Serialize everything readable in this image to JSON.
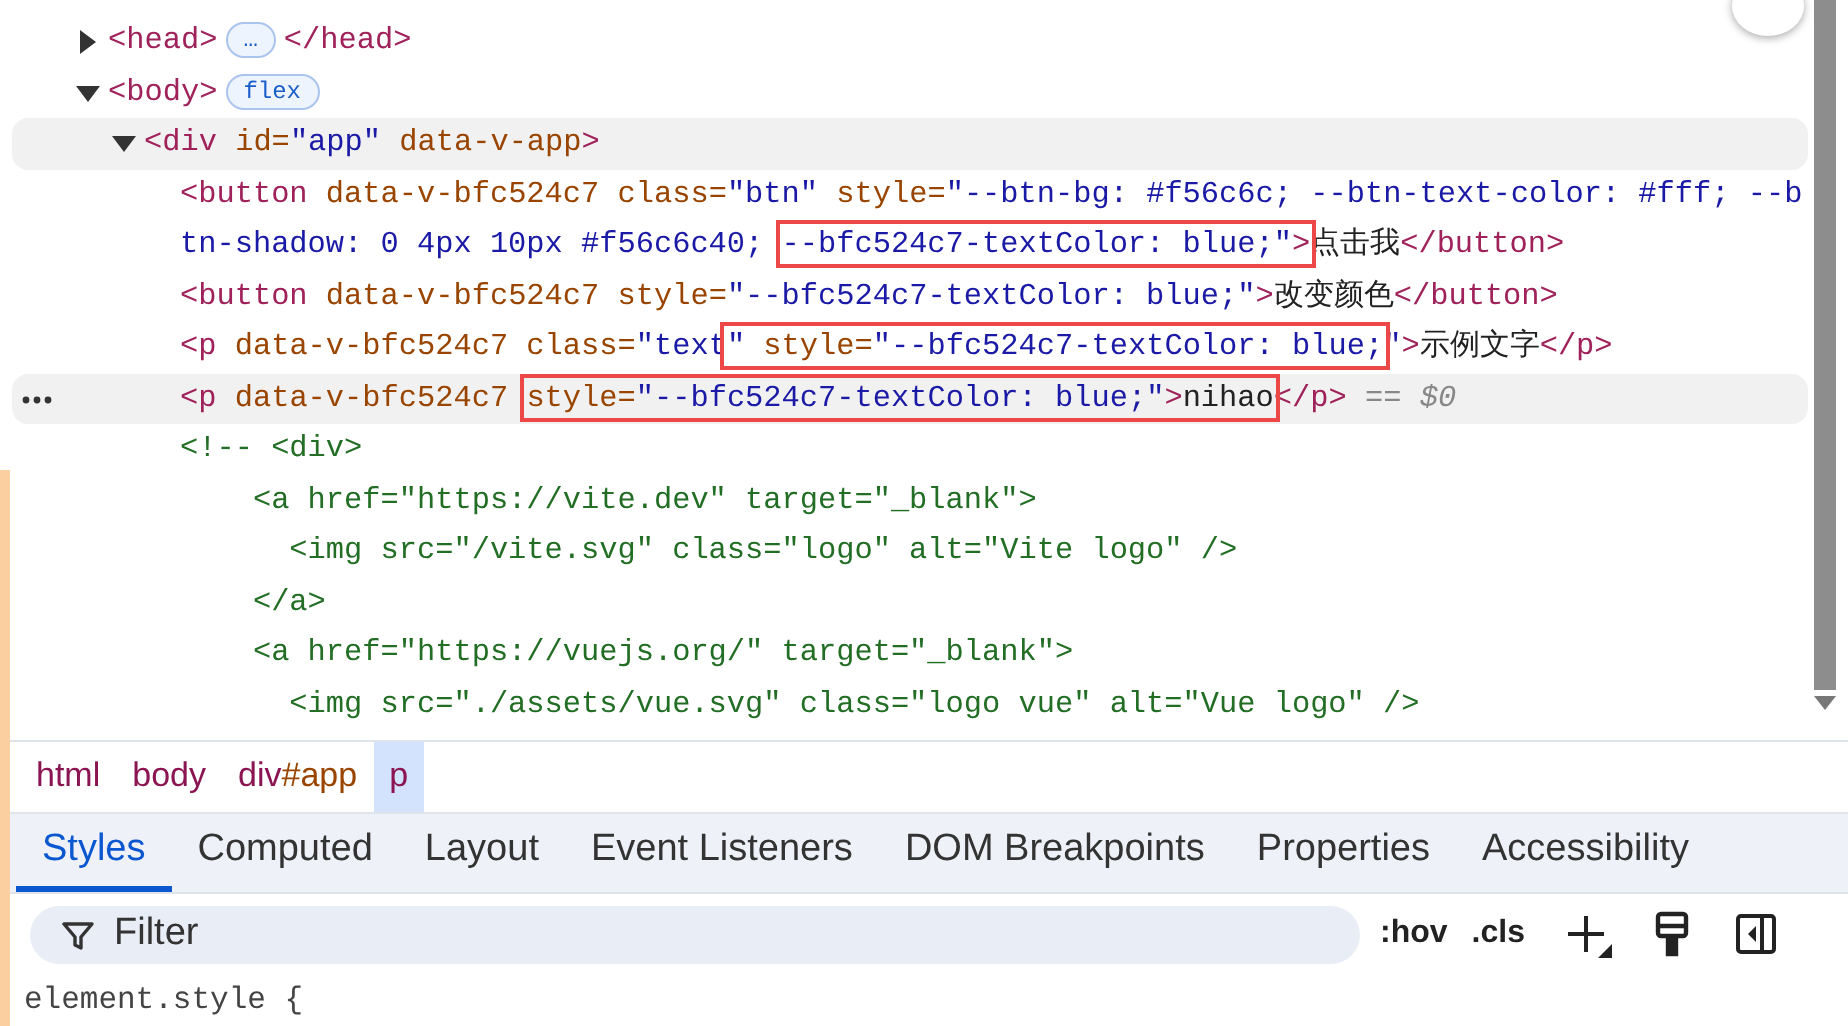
{
  "elements_tree": [
    {
      "expanded": false,
      "hovered": false,
      "selected": false,
      "segments": [
        {
          "kind": "tag",
          "text": "<head>"
        },
        {
          "kind": "badge",
          "text": "…"
        },
        {
          "kind": "tag",
          "text": "</head>"
        }
      ]
    },
    {
      "expanded": true,
      "hovered": false,
      "selected": false,
      "segments": [
        {
          "kind": "tag",
          "text": "<body>"
        },
        {
          "kind": "badge",
          "text": "flex"
        }
      ],
      "children": [
        {
          "expanded": true,
          "hovered": true,
          "selected": false,
          "segments": [
            {
              "kind": "tag",
              "text": "<div"
            },
            {
              "kind": "attr",
              "text": " id="
            },
            {
              "kind": "value",
              "text": "\"app\""
            },
            {
              "kind": "attr",
              "text": " data-v-app"
            },
            {
              "kind": "tag",
              "text": ">"
            }
          ],
          "children": [
            {
              "hovered": false,
              "selected": false,
              "segments": [
                {
                  "kind": "tag",
                  "text": "<button"
                },
                {
                  "kind": "attr",
                  "text": " data-v-bfc524c7 class="
                },
                {
                  "kind": "value",
                  "text": "\"btn\""
                },
                {
                  "kind": "attr",
                  "text": " style="
                },
                {
                  "kind": "value",
                  "text": "\"--btn-bg: #f56c6c; --btn-text-color: #fff; --btn-shadow: 0 4px 10px #f56c6c40; "
                },
                {
                  "kind": "value",
                  "text": "--bfc524c7-textColor: blue;\"",
                  "boxed": true
                },
                {
                  "kind": "tag",
                  "text": ">",
                  "boxed": true
                },
                {
                  "kind": "text",
                  "text": "点击我"
                },
                {
                  "kind": "tag",
                  "text": "</button>"
                }
              ]
            },
            {
              "hovered": false,
              "selected": false,
              "segments": [
                {
                  "kind": "tag",
                  "text": "<button"
                },
                {
                  "kind": "attr",
                  "text": " data-v-bfc524c7 style="
                },
                {
                  "kind": "value",
                  "text": "\"--bfc524c7-textColor: blue;\""
                },
                {
                  "kind": "tag",
                  "text": ">"
                },
                {
                  "kind": "text",
                  "text": "改变颜色"
                },
                {
                  "kind": "tag",
                  "text": "</button>"
                }
              ]
            },
            {
              "hovered": false,
              "selected": false,
              "segments": [
                {
                  "kind": "tag",
                  "text": "<p"
                },
                {
                  "kind": "attr",
                  "text": " data-v-bfc524c7 class="
                },
                {
                  "kind": "value",
                  "text": "\"text"
                },
                {
                  "kind": "value",
                  "text": "\"",
                  "boxed": true
                },
                {
                  "kind": "attr",
                  "text": " style=",
                  "boxed": true
                },
                {
                  "kind": "value",
                  "text": "\"--bfc524c7-textColor: blue;",
                  "boxed": true
                },
                {
                  "kind": "value",
                  "text": "\""
                },
                {
                  "kind": "tag",
                  "text": ">"
                },
                {
                  "kind": "text",
                  "text": "示例文字"
                },
                {
                  "kind": "tag",
                  "text": "</p>"
                }
              ]
            },
            {
              "hovered": false,
              "selected": true,
              "suffix": "== $0",
              "segments": [
                {
                  "kind": "tag",
                  "text": "<p"
                },
                {
                  "kind": "attr",
                  "text": " data-v-bfc524c7 "
                },
                {
                  "kind": "attr",
                  "text": "style=",
                  "boxed": true
                },
                {
                  "kind": "value",
                  "text": "\"--bfc524c7-textColor: blue;\"",
                  "boxed": true
                },
                {
                  "kind": "tag",
                  "text": ">",
                  "boxed": true
                },
                {
                  "kind": "text",
                  "text": "nihao",
                  "boxed": true
                },
                {
                  "kind": "tag",
                  "text": "</p>"
                }
              ]
            },
            {
              "kind": "comment",
              "lines": [
                "<!-- <div>",
                "    <a href=\"https://vite.dev\" target=\"_blank\">",
                "      <img src=\"/vite.svg\" class=\"logo\" alt=\"Vite logo\" />",
                "    </a>",
                "    <a href=\"https://vuejs.org/\" target=\"_blank\">",
                "      <img src=\"./assets/vue.svg\" class=\"logo vue\" alt=\"Vue logo\" />"
              ]
            }
          ]
        }
      ]
    }
  ],
  "breadcrumbs": [
    {
      "tag": "html",
      "selected": false
    },
    {
      "tag": "body",
      "selected": false
    },
    {
      "tag": "div",
      "id": "#app",
      "selected": false
    },
    {
      "tag": "p",
      "selected": true
    }
  ],
  "tabs": [
    {
      "label": "Styles",
      "selected": true
    },
    {
      "label": "Computed",
      "selected": false
    },
    {
      "label": "Layout",
      "selected": false
    },
    {
      "label": "Event Listeners",
      "selected": false
    },
    {
      "label": "DOM Breakpoints",
      "selected": false
    },
    {
      "label": "Properties",
      "selected": false
    },
    {
      "label": "Accessibility",
      "selected": false
    }
  ],
  "filter": {
    "placeholder": "Filter"
  },
  "toolbar": {
    "hov": ":hov",
    "cls": ".cls"
  },
  "styles_rule": "element.style {"
}
